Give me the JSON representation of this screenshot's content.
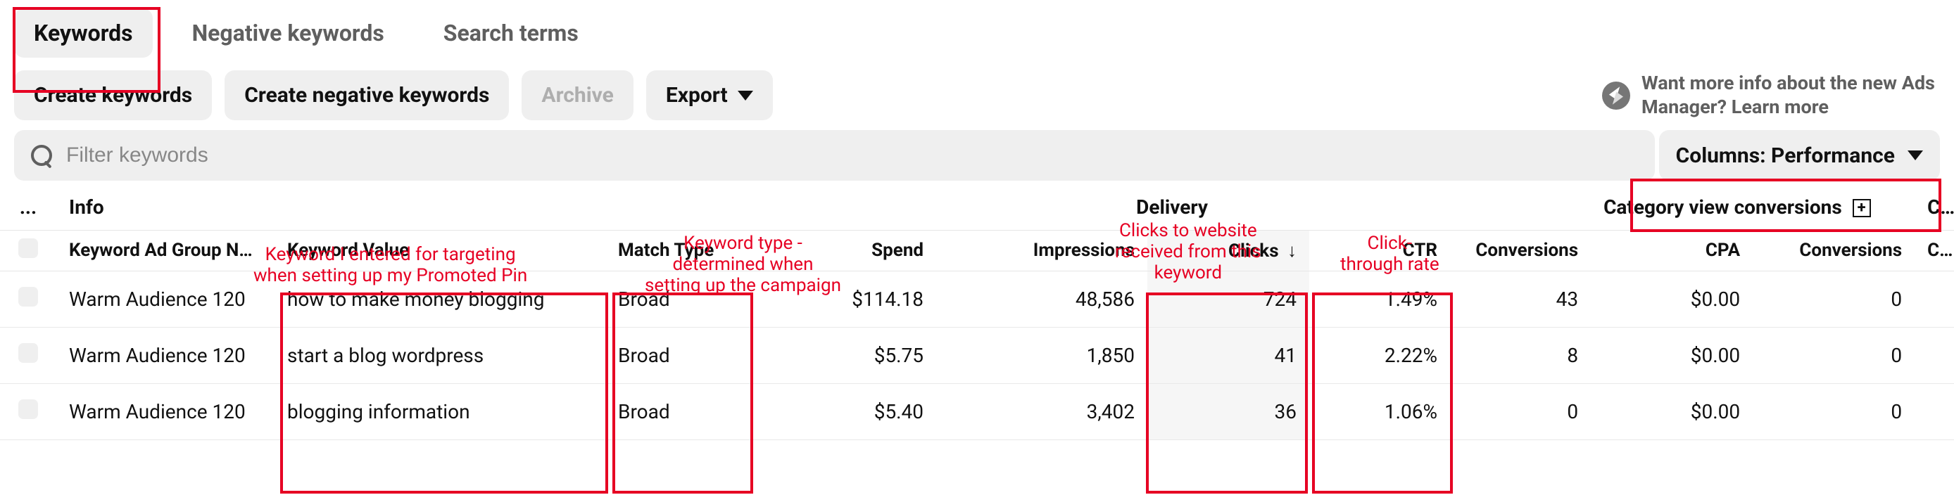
{
  "tabs": {
    "keywords": "Keywords",
    "negative": "Negative keywords",
    "search_terms": "Search terms"
  },
  "actions": {
    "create_keywords": "Create keywords",
    "create_negative": "Create negative keywords",
    "archive": "Archive",
    "export": "Export"
  },
  "info_cta": "Want more info about the new Ads Manager? Learn more",
  "filter": {
    "placeholder": "Filter keywords"
  },
  "columns_btn": "Columns: Performance",
  "group_headers": {
    "ellipsis": "...",
    "info": "Info",
    "delivery": "Delivery",
    "category_view": "Category view conversions",
    "checkout": "Chec"
  },
  "columns": {
    "ad_group": "Keyword Ad Group Nam",
    "keyword_value": "Keyword Value",
    "match_type": "Match Type",
    "spend": "Spend",
    "impressions": "Impressions",
    "clicks": "Clicks",
    "ctr": "CTR",
    "conversions": "Conversions",
    "cpa": "CPA",
    "conversions2": "Conversions",
    "cpa2": "CPA"
  },
  "rows": [
    {
      "ad_group": "Warm Audience 120",
      "keyword_value": "how to make money blogging",
      "match_type": "Broad",
      "spend": "$114.18",
      "impressions": "48,586",
      "clicks": "724",
      "ctr": "1.49%",
      "conversions": "43",
      "cpa": "$0.00",
      "conversions2": "0"
    },
    {
      "ad_group": "Warm Audience 120",
      "keyword_value": "start a blog wordpress",
      "match_type": "Broad",
      "spend": "$5.75",
      "impressions": "1,850",
      "clicks": "41",
      "ctr": "2.22%",
      "conversions": "8",
      "cpa": "$0.00",
      "conversions2": "0"
    },
    {
      "ad_group": "Warm Audience 120",
      "keyword_value": "blogging information",
      "match_type": "Broad",
      "spend": "$5.40",
      "impressions": "3,402",
      "clicks": "36",
      "ctr": "1.06%",
      "conversions": "0",
      "cpa": "$0.00",
      "conversions2": "0"
    }
  ],
  "annotations": {
    "keyword_entered": "Keyword I entered for targeting\nwhen setting up my Promoted Pin",
    "keyword_type": "Keyword type -\ndetermined when\nsetting up the campaign",
    "clicks_website": "Clicks to website\nreceived from this\nkeyword",
    "ctr_label": "Click-\nthrough rate"
  }
}
